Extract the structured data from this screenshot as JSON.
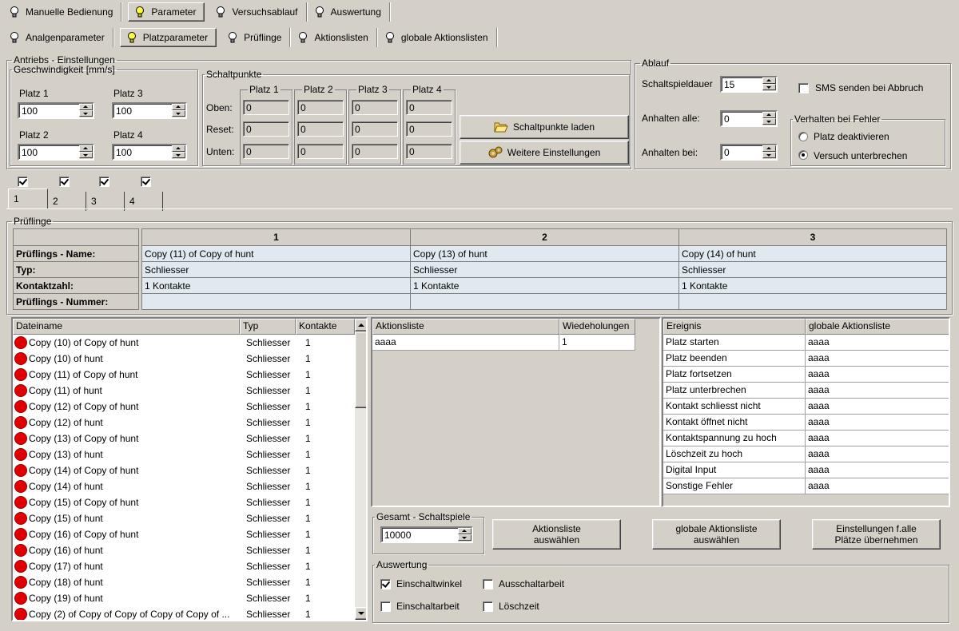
{
  "main_tabs": [
    {
      "label": "Manuelle Bedienung",
      "active": false
    },
    {
      "label": "Parameter",
      "active": true
    },
    {
      "label": "Versuchsablauf",
      "active": false
    },
    {
      "label": "Auswertung",
      "active": false
    }
  ],
  "sub_tabs": [
    {
      "label": "Analgenparameter",
      "active": false
    },
    {
      "label": "Platzparameter",
      "active": true
    },
    {
      "label": "Prüflinge",
      "active": false
    },
    {
      "label": "Aktionslisten",
      "active": false
    },
    {
      "label": "globale Aktionslisten",
      "active": false
    }
  ],
  "antriebs": {
    "legend": "Antriebs - Einstellungen",
    "geschw_legend": "Geschwindigkeit [mm/s]",
    "p1_label": "Platz 1",
    "p1_value": "100",
    "p2_label": "Platz 2",
    "p2_value": "100",
    "p3_label": "Platz 3",
    "p3_value": "100",
    "p4_label": "Platz 4",
    "p4_value": "100",
    "schalt_legend": "Schaltpunkte",
    "cols": [
      "Platz 1",
      "Platz 2",
      "Platz 3",
      "Platz 4"
    ],
    "rows": [
      {
        "label": "Oben:",
        "values": [
          "0",
          "0",
          "0",
          "0"
        ]
      },
      {
        "label": "Reset:",
        "values": [
          "0",
          "0",
          "0",
          "0"
        ]
      },
      {
        "label": "Unten:",
        "values": [
          "0",
          "0",
          "0",
          "0"
        ]
      }
    ],
    "btn_laden": "Schaltpunkte laden",
    "btn_weitere": "Weitere Einstellungen"
  },
  "ablauf": {
    "legend": "Ablauf",
    "schaltspieldauer_label": "Schaltspieldauer",
    "schaltspieldauer": "15",
    "anhalten_alle_label": "Anhalten alle:",
    "anhalten_alle": "0",
    "anhalten_bei_label": "Anhalten bei:",
    "anhalten_bei": "0",
    "sms_label": "SMS senden bei Abbruch",
    "sms_checked": false,
    "fehler_legend": "Verhalten bei Fehler",
    "radio1": "Platz deaktivieren",
    "radio2": "Versuch unterbrechen",
    "selected": 2
  },
  "platz_checks": [
    true,
    true,
    true,
    true
  ],
  "platz_tabs": [
    "1",
    "2",
    "3",
    "4"
  ],
  "pruef": {
    "legend": "Prüflinge",
    "cols": [
      "1",
      "2",
      "3"
    ],
    "rows": [
      {
        "label": "Prüflings - Name:",
        "values": [
          "Copy (11) of Copy of hunt",
          "Copy (13) of hunt",
          "Copy (14) of hunt"
        ]
      },
      {
        "label": "Typ:",
        "values": [
          "Schliesser",
          "Schliesser",
          "Schliesser"
        ]
      },
      {
        "label": "Kontaktzahl:",
        "values": [
          "1 Kontakte",
          "1 Kontakte",
          "1 Kontakte"
        ]
      },
      {
        "label": "Prüflings - Nummer:",
        "values": [
          "",
          "",
          ""
        ]
      }
    ]
  },
  "filelist": {
    "headers": [
      "Dateiname",
      "Typ",
      "Kontakte"
    ],
    "rows": [
      [
        "Copy (10) of Copy of hunt",
        "Schliesser",
        "1"
      ],
      [
        "Copy (10) of hunt",
        "Schliesser",
        "1"
      ],
      [
        "Copy (11) of Copy of hunt",
        "Schliesser",
        "1"
      ],
      [
        "Copy (11) of hunt",
        "Schliesser",
        "1"
      ],
      [
        "Copy (12) of Copy of hunt",
        "Schliesser",
        "1"
      ],
      [
        "Copy (12) of hunt",
        "Schliesser",
        "1"
      ],
      [
        "Copy (13) of Copy of hunt",
        "Schliesser",
        "1"
      ],
      [
        "Copy (13) of hunt",
        "Schliesser",
        "1"
      ],
      [
        "Copy (14) of Copy of hunt",
        "Schliesser",
        "1"
      ],
      [
        "Copy (14) of hunt",
        "Schliesser",
        "1"
      ],
      [
        "Copy (15) of Copy of hunt",
        "Schliesser",
        "1"
      ],
      [
        "Copy (15) of hunt",
        "Schliesser",
        "1"
      ],
      [
        "Copy (16) of Copy of hunt",
        "Schliesser",
        "1"
      ],
      [
        "Copy (16) of hunt",
        "Schliesser",
        "1"
      ],
      [
        "Copy (17) of hunt",
        "Schliesser",
        "1"
      ],
      [
        "Copy (18) of hunt",
        "Schliesser",
        "1"
      ],
      [
        "Copy (19) of hunt",
        "Schliesser",
        "1"
      ],
      [
        "Copy (2) of Copy of Copy of Copy of Copy of ...",
        "Schliesser",
        "1"
      ]
    ]
  },
  "aktion": {
    "headers": [
      "Aktionsliste",
      "Wiedeholungen"
    ],
    "rows": [
      [
        "aaaa",
        "1"
      ]
    ]
  },
  "ereignis": {
    "headers": [
      "Ereignis",
      "globale Aktionsliste"
    ],
    "rows": [
      [
        "Platz starten",
        "aaaa"
      ],
      [
        "Platz beenden",
        "aaaa"
      ],
      [
        "Platz fortsetzen",
        "aaaa"
      ],
      [
        "Platz unterbrechen",
        "aaaa"
      ],
      [
        "Kontakt schliesst nicht",
        "aaaa"
      ],
      [
        "Kontakt öffnet nicht",
        "aaaa"
      ],
      [
        "Kontaktspannung zu hoch",
        "aaaa"
      ],
      [
        "Löschzeit zu hoch",
        "aaaa"
      ],
      [
        "Digital Input",
        "aaaa"
      ],
      [
        "Sonstige Fehler",
        "aaaa"
      ]
    ]
  },
  "gesamt": {
    "legend": "Gesamt - Schaltspiele",
    "value": "10000"
  },
  "buttons": {
    "aktionsliste": "Aktionsliste auswählen",
    "globale": "globale Aktionsliste auswählen",
    "einstellungen": "Einstellungen f.alle Plätze übernehmen"
  },
  "auswertung": {
    "legend": "Auswertung",
    "items": [
      {
        "label": "Einschaltwinkel",
        "checked": true
      },
      {
        "label": "Ausschaltarbeit",
        "checked": false
      },
      {
        "label": "Einschaltarbeit",
        "checked": false
      },
      {
        "label": "Löschzeit",
        "checked": false
      }
    ]
  }
}
